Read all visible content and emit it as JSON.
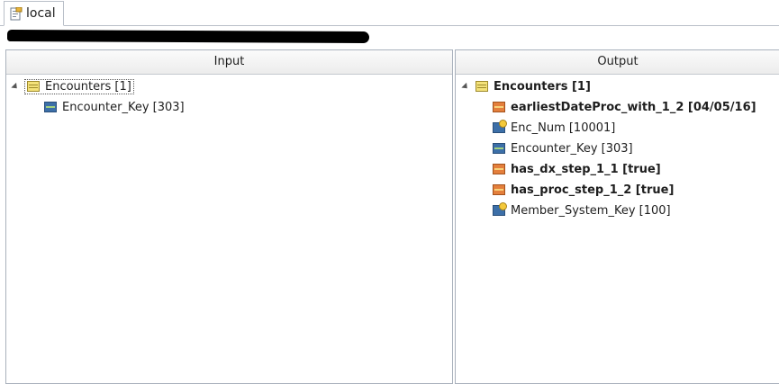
{
  "tab": {
    "label": "local"
  },
  "input": {
    "header": "Input",
    "root": {
      "label": "Encounters [1]"
    },
    "children": [
      {
        "label": "Encounter_Key [303]"
      }
    ]
  },
  "output": {
    "header": "Output",
    "root": {
      "label": "Encounters [1]"
    },
    "children": [
      {
        "label": "earliestDateProc_with_1_2 [04/05/16]"
      },
      {
        "label": "Enc_Num [10001]"
      },
      {
        "label": "Encounter_Key [303]"
      },
      {
        "label": "has_dx_step_1_1 [true]"
      },
      {
        "label": "has_proc_step_1_2 [true]"
      },
      {
        "label": "Member_System_Key [100]"
      }
    ]
  }
}
